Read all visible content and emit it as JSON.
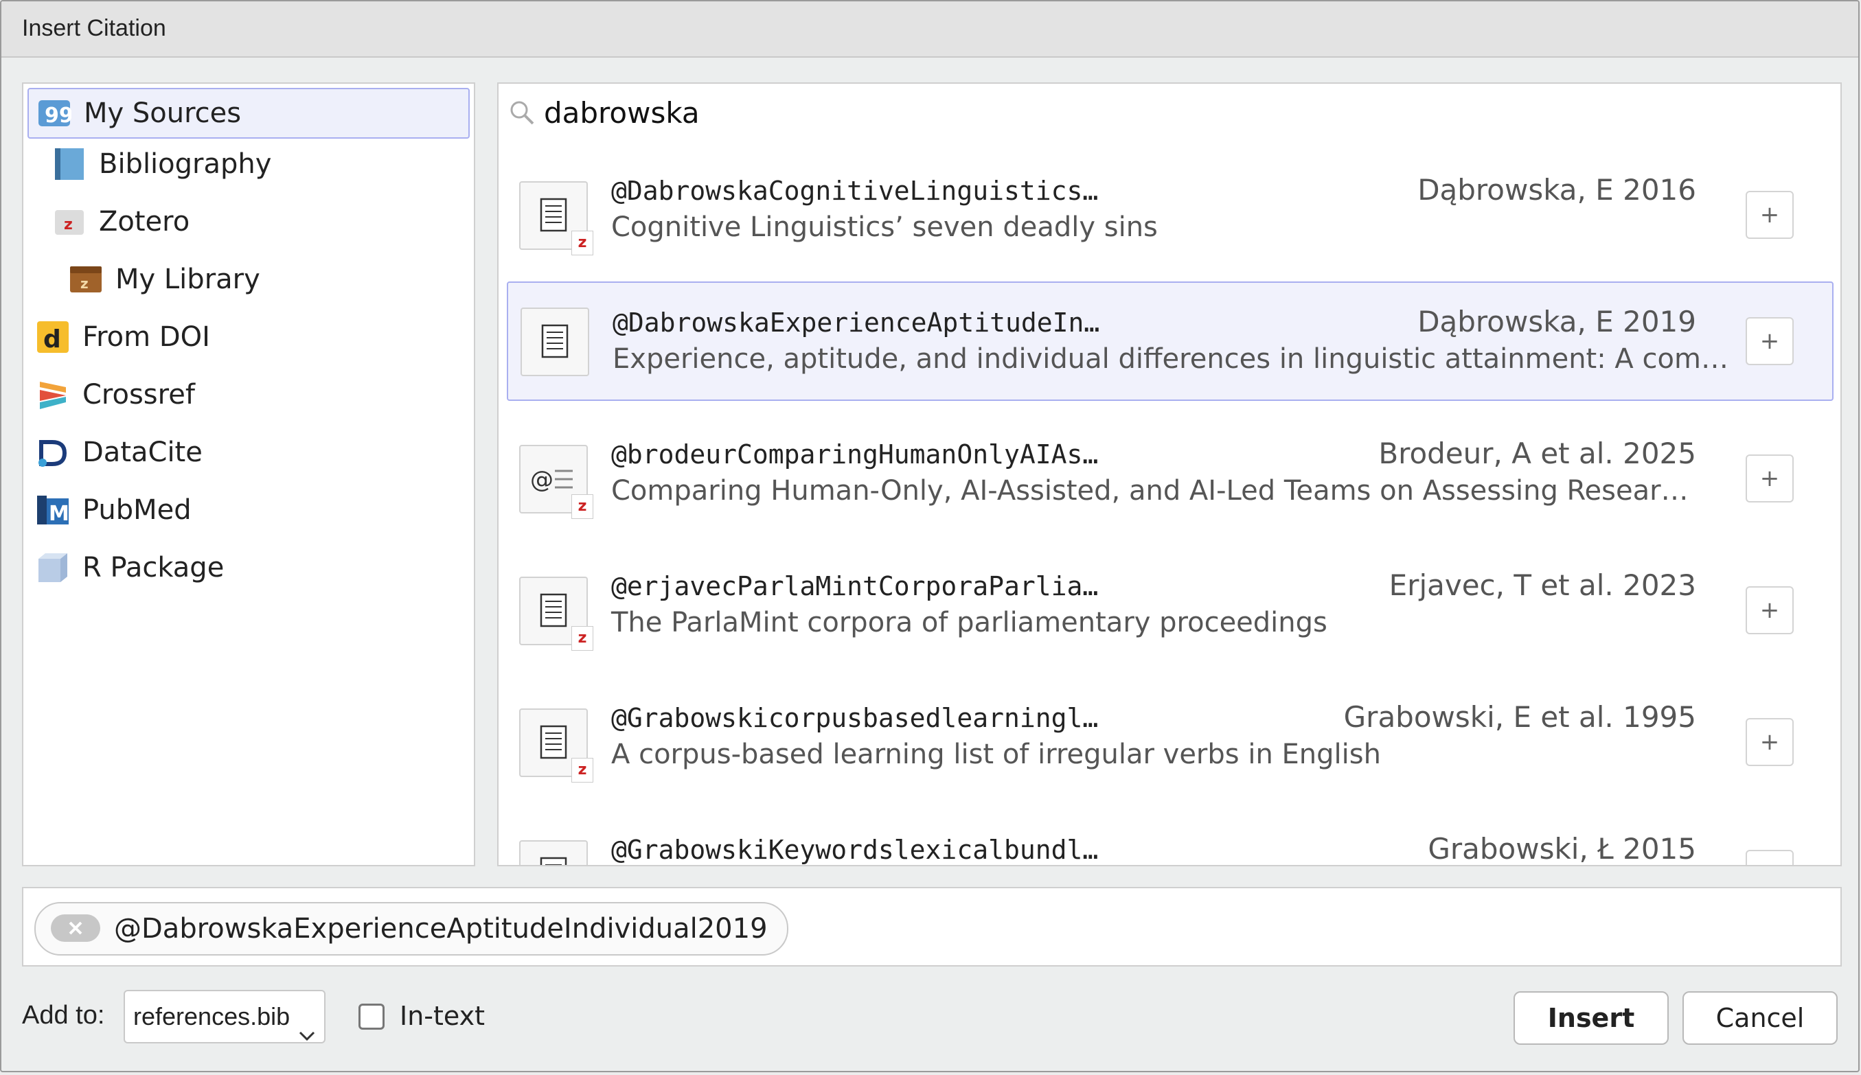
{
  "window": {
    "title": "Insert Citation"
  },
  "sources": [
    {
      "label": "My Sources",
      "icon": "my-sources-icon",
      "selected": true
    },
    {
      "label": "Bibliography",
      "icon": "bibliography-icon"
    },
    {
      "label": "Zotero",
      "icon": "zotero-folder-icon"
    },
    {
      "label": "My Library",
      "icon": "library-box-icon"
    },
    {
      "label": "From DOI",
      "icon": "doi-icon"
    },
    {
      "label": "Crossref",
      "icon": "crossref-icon"
    },
    {
      "label": "DataCite",
      "icon": "datacite-icon"
    },
    {
      "label": "PubMed",
      "icon": "pubmed-icon"
    },
    {
      "label": "R Package",
      "icon": "r-package-icon"
    }
  ],
  "search": {
    "value": "dabrowska",
    "icon": "search-icon"
  },
  "results": [
    {
      "key": "@DabrowskaCognitiveLinguistics…",
      "author": "Dąbrowska, E 2016",
      "title": "Cognitive Linguistics’ seven deadly sins",
      "icon": "document-icon",
      "zotero": true,
      "add_label": "+"
    },
    {
      "key": "@DabrowskaExperienceAptitudeIn…",
      "author": "Dąbrowska, E 2019",
      "title": "Experience, aptitude, and individual differences in linguistic attainment: A com…",
      "icon": "document-icon",
      "zotero": false,
      "selected": true,
      "add_label": "+"
    },
    {
      "key": "@brodeurComparingHumanOnlyAIAs…",
      "author": "Brodeur, A et al. 2025",
      "title": "Comparing Human-Only, AI-Assisted, and AI-Led Teams on Assessing Resear…",
      "icon": "web-document-icon",
      "zotero": true,
      "add_label": "+"
    },
    {
      "key": "@erjavecParlaMintCorporaParlia…",
      "author": "Erjavec, T et al. 2023",
      "title": "The ParlaMint corpora of parliamentary proceedings",
      "icon": "document-icon",
      "zotero": true,
      "add_label": "+"
    },
    {
      "key": "@Grabowskicorpusbasedlearningl…",
      "author": "Grabowski, E et al. 1995",
      "title": "A corpus-based learning list of irregular verbs in English",
      "icon": "document-icon",
      "zotero": true,
      "add_label": "+"
    },
    {
      "key": "@GrabowskiKeywordslexicalbundl…",
      "author": "Grabowski, Ł 2015",
      "title": "",
      "icon": "document-icon",
      "zotero": false,
      "add_label": "+"
    }
  ],
  "zotero_badge": "z",
  "selected_citation": "@DabrowskaExperienceAptitudeIndividual2019",
  "footer": {
    "add_to_label": "Add to:",
    "add_to_value": "references.bib",
    "intext_label": "In-text",
    "intext_checked": false,
    "insert_label": "Insert",
    "cancel_label": "Cancel"
  },
  "colors": {
    "selection_border": "#a9aff0",
    "selection_fill": "#eef0fb",
    "zotero_red": "#cc2222"
  }
}
